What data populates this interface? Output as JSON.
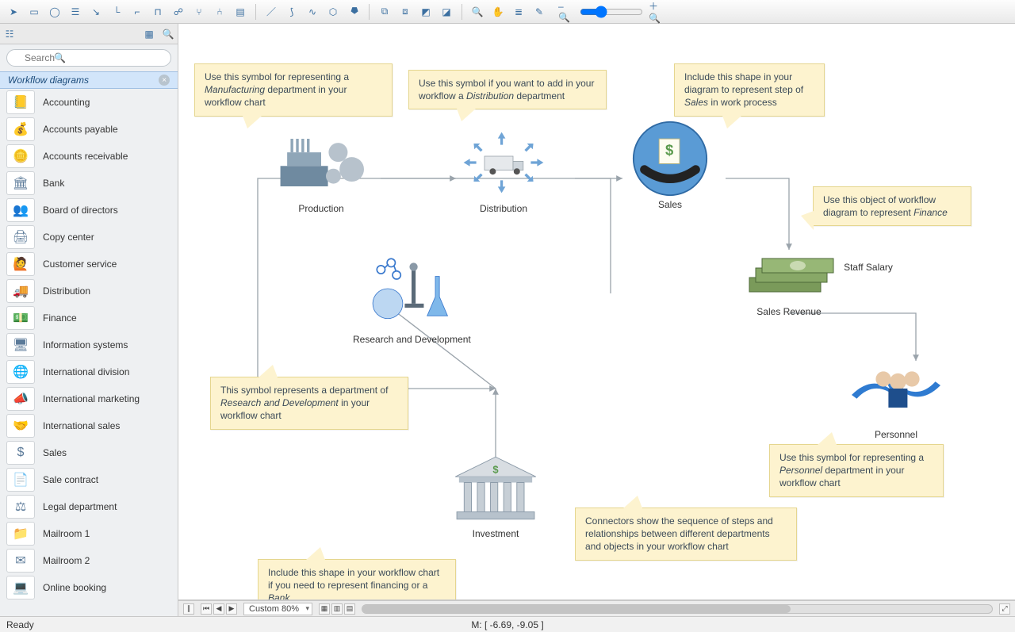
{
  "toolbar": {
    "icons": [
      "pointer",
      "rect",
      "ellipse",
      "text",
      "conn-straight",
      "conn-l",
      "conn-z",
      "conn-u",
      "conn-tree",
      "conn-branch",
      "conn-multi",
      "page",
      "line",
      "arc",
      "curve",
      "poly",
      "poly-closed",
      "group",
      "ungroup",
      "front",
      "back",
      "zoom-in",
      "hand",
      "layers",
      "eyedrop",
      "zoom-out-btn",
      "zoom-in-btn"
    ]
  },
  "sidebar": {
    "search_placeholder": "Search",
    "group_title": "Workflow diagrams",
    "items": [
      {
        "label": "Accounting",
        "glyph": "📒"
      },
      {
        "label": "Accounts payable",
        "glyph": "💰"
      },
      {
        "label": "Accounts receivable",
        "glyph": "🪙"
      },
      {
        "label": "Bank",
        "glyph": "🏛"
      },
      {
        "label": "Board of directors",
        "glyph": "👥"
      },
      {
        "label": "Copy center",
        "glyph": "🖨"
      },
      {
        "label": "Customer service",
        "glyph": "🙋"
      },
      {
        "label": "Distribution",
        "glyph": "🚚"
      },
      {
        "label": "Finance",
        "glyph": "💵"
      },
      {
        "label": "Information systems",
        "glyph": "🖥"
      },
      {
        "label": "International division",
        "glyph": "🌐"
      },
      {
        "label": "International marketing",
        "glyph": "📣"
      },
      {
        "label": "International sales",
        "glyph": "🤝"
      },
      {
        "label": "Sales",
        "glyph": "$"
      },
      {
        "label": "Sale contract",
        "glyph": "📄"
      },
      {
        "label": "Legal department",
        "glyph": "⚖"
      },
      {
        "label": "Mailroom 1",
        "glyph": "📁"
      },
      {
        "label": "Mailroom 2",
        "glyph": "✉"
      },
      {
        "label": "Online booking",
        "glyph": "💻"
      }
    ]
  },
  "canvas": {
    "nodes": {
      "production": "Production",
      "distribution": "Distribution",
      "sales": "Sales",
      "revenue": "Sales Revenue",
      "staff": "Staff Salary",
      "rnd": "Research and Development",
      "personnel": "Personnel",
      "investment": "Investment"
    },
    "callouts": {
      "production": "Use this symbol for representing a <em>Manufacturing</em> department in your workflow chart",
      "distribution": "Use this symbol if you want to add in your workflow a <em>Distribution</em> department",
      "sales": "Include this shape in your diagram to represent step of <em>Sales</em> in work process",
      "finance": "Use this object of workflow diagram to represent <em>Finance</em>",
      "rnd": "This symbol represents a department of <em>Research and Development</em> in your workflow chart",
      "personnel": "Use this symbol for representing a <em>Personnel</em> department in your workflow chart",
      "connectors": "Connectors show the sequence of steps and relationships between different departments and objects in your workflow chart",
      "bank": "Include this shape in your workflow chart if you need to represent financing or a <em>Bank</em>"
    }
  },
  "footer": {
    "zoom_label": "Custom 80%"
  },
  "status": {
    "ready": "Ready",
    "mouse": "M: [ -6.69, -9.05 ]"
  }
}
